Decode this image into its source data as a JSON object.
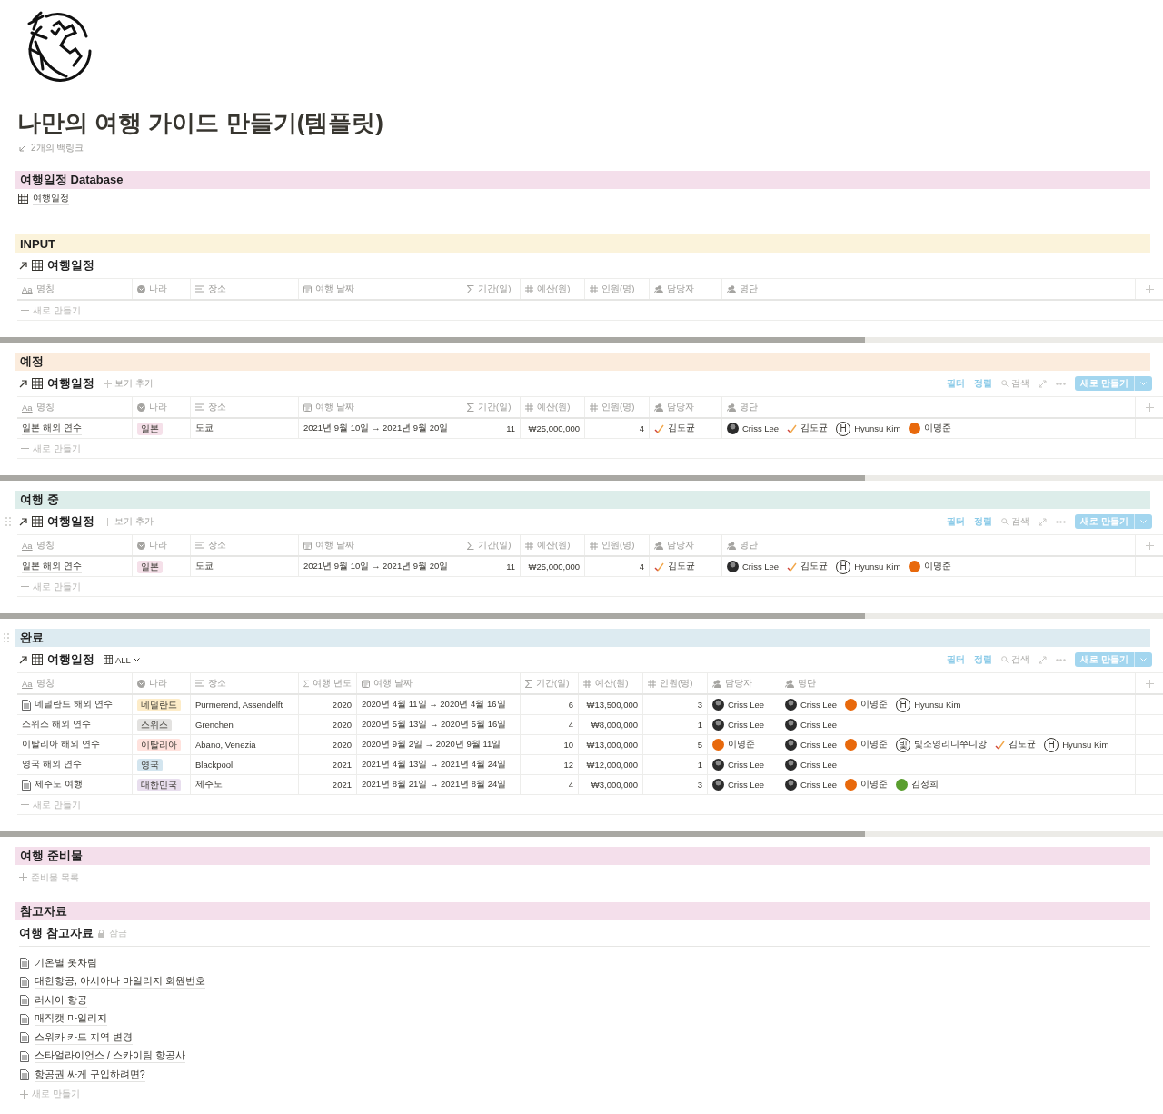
{
  "page": {
    "title": "나만의 여행 가이드 만들기(템플릿)",
    "backlinks": "2개의 백링크"
  },
  "sections": [
    {
      "kind": "link",
      "heading": "여행일정 Database",
      "color": "#f4dfeb",
      "link": "여행일정"
    },
    {
      "kind": "database",
      "heading": "INPUT",
      "color": "#fbf3db",
      "view": {
        "title": "여행일정",
        "columns": [
          {
            "kind": "title",
            "glyph": "Aa",
            "label": "명칭"
          },
          {
            "kind": "select",
            "label": "나라"
          },
          {
            "kind": "text",
            "label": "장소"
          },
          {
            "kind": "date",
            "label": "여행 날짜"
          },
          {
            "kind": "formula",
            "label": "기간(일)"
          },
          {
            "kind": "number",
            "label": "예산(원)"
          },
          {
            "kind": "number",
            "label": "인원(명)"
          },
          {
            "kind": "people",
            "label": "담당자"
          },
          {
            "kind": "people",
            "label": "명단"
          }
        ],
        "add_row": "새로 만들기"
      }
    },
    {
      "kind": "database",
      "heading": "예정",
      "color": "#fbecdd",
      "view": {
        "title": "여행일정",
        "view_add": "보기 추가",
        "toolbar": {
          "filter": "필터",
          "sort": "정렬",
          "search": "검색",
          "new": "새로 만들기"
        },
        "columns": [
          {
            "kind": "title",
            "glyph": "Aa",
            "label": "명칭"
          },
          {
            "kind": "select",
            "label": "나라"
          },
          {
            "kind": "text",
            "label": "장소"
          },
          {
            "kind": "date",
            "label": "여행 날짜"
          },
          {
            "kind": "formula",
            "label": "기간(일)"
          },
          {
            "kind": "number",
            "label": "예산(원)"
          },
          {
            "kind": "number",
            "label": "인원(명)"
          },
          {
            "kind": "people",
            "label": "담당자"
          },
          {
            "kind": "people",
            "label": "명단"
          }
        ],
        "rows": [
          {
            "doc_icon": false,
            "cells": [
              "일본 해외 연수",
              {
                "label": "일본",
                "color": "#f5e0e9"
              },
              "도쿄",
              "2021년 9월 10일 → 2021년 9월 20일",
              "11",
              "₩25,000,000",
              "4",
              [
                {
                  "kind": "check",
                  "name": "김도균"
                }
              ],
              [
                {
                  "kind": "photo",
                  "name": "Criss Lee"
                },
                {
                  "kind": "check",
                  "name": "김도균"
                },
                {
                  "kind": "letter",
                  "letter": "H",
                  "name": "Hyunsu Kim"
                },
                {
                  "kind": "dot",
                  "color": "#e8690c",
                  "name": "이명준"
                }
              ]
            ]
          }
        ],
        "add_row": "새로 만들기"
      }
    },
    {
      "kind": "database",
      "heading": "여행 중",
      "color": "#ddedea",
      "view": {
        "title": "여행일정",
        "drag_handle": true,
        "view_add": "보기 추가",
        "toolbar": {
          "filter": "필터",
          "sort": "정렬",
          "search": "검색",
          "new": "새로 만들기"
        },
        "columns": [
          {
            "kind": "title",
            "glyph": "Aa",
            "label": "명칭"
          },
          {
            "kind": "select",
            "label": "나라"
          },
          {
            "kind": "text",
            "label": "장소"
          },
          {
            "kind": "date",
            "label": "여행 날짜"
          },
          {
            "kind": "formula",
            "label": "기간(일)"
          },
          {
            "kind": "number",
            "label": "예산(원)"
          },
          {
            "kind": "number",
            "label": "인원(명)"
          },
          {
            "kind": "people",
            "label": "담당자"
          },
          {
            "kind": "people",
            "label": "명단"
          }
        ],
        "rows": [
          {
            "doc_icon": false,
            "cells": [
              "일본 해외 연수",
              {
                "label": "일본",
                "color": "#f5e0e9"
              },
              "도쿄",
              "2021년 9월 10일 → 2021년 9월 20일",
              "11",
              "₩25,000,000",
              "4",
              [
                {
                  "kind": "check",
                  "name": "김도균"
                }
              ],
              [
                {
                  "kind": "photo",
                  "name": "Criss Lee"
                },
                {
                  "kind": "check",
                  "name": "김도균"
                },
                {
                  "kind": "letter",
                  "letter": "H",
                  "name": "Hyunsu Kim"
                },
                {
                  "kind": "dot",
                  "color": "#e8690c",
                  "name": "이명준"
                }
              ]
            ]
          }
        ],
        "add_row": "새로 만들기"
      }
    },
    {
      "kind": "database",
      "heading": "완료",
      "drag_handle": true,
      "color": "#ddebf1",
      "view": {
        "title": "여행일정",
        "view_menu": "ALL",
        "toolbar": {
          "filter": "필터",
          "sort": "정렬",
          "search": "검색",
          "new": "새로 만들기"
        },
        "columns": [
          {
            "kind": "title",
            "glyph": "Aa",
            "label": "명칭"
          },
          {
            "kind": "select",
            "label": "나라"
          },
          {
            "kind": "text",
            "label": "장소"
          },
          {
            "kind": "year",
            "label": "여행 년도"
          },
          {
            "kind": "date",
            "label": "여행 날짜"
          },
          {
            "kind": "formula",
            "label": "기간(일)"
          },
          {
            "kind": "number",
            "label": "예산(원)"
          },
          {
            "kind": "number",
            "label": "인원(명)"
          },
          {
            "kind": "people",
            "label": "담당자"
          },
          {
            "kind": "people",
            "label": "명단"
          }
        ],
        "rows": [
          {
            "doc_icon": true,
            "cells": [
              "네덜란드 해외 연수",
              {
                "label": "네덜란드",
                "color": "#fdecc8"
              },
              "Purmerend, Assendelft",
              "2020",
              "2020년 4월 11일 → 2020년 4월 16일",
              "6",
              "₩13,500,000",
              "3",
              [
                {
                  "kind": "photo",
                  "name": "Criss Lee"
                }
              ],
              [
                {
                  "kind": "photo",
                  "name": "Criss Lee"
                },
                {
                  "kind": "dot",
                  "color": "#e8690c",
                  "name": "이명준"
                },
                {
                  "kind": "letter",
                  "letter": "H",
                  "name": "Hyunsu Kim"
                }
              ]
            ]
          },
          {
            "doc_icon": false,
            "cells": [
              "스위스 해외 연수",
              {
                "label": "스위스",
                "color": "#e3e2e0"
              },
              "Grenchen",
              "2020",
              "2020년 5월 13일 → 2020년 5월 16일",
              "4",
              "₩8,000,000",
              "1",
              [
                {
                  "kind": "photo",
                  "name": "Criss Lee"
                }
              ],
              [
                {
                  "kind": "photo",
                  "name": "Criss Lee"
                }
              ]
            ]
          },
          {
            "doc_icon": false,
            "cells": [
              "이탈리아 해외 연수",
              {
                "label": "이탈리아",
                "color": "#ffe2dd"
              },
              "Abano, Venezia",
              "2020",
              "2020년 9월 2일 → 2020년 9월 11일",
              "10",
              "₩13,000,000",
              "5",
              [
                {
                  "kind": "dot",
                  "color": "#e8690c",
                  "name": "이명준"
                }
              ],
              [
                {
                  "kind": "photo",
                  "name": "Criss Lee"
                },
                {
                  "kind": "dot",
                  "color": "#e8690c",
                  "name": "이명준"
                },
                {
                  "kind": "letter",
                  "letter": "빛",
                  "name": "빛소영리니쭈니앙"
                },
                {
                  "kind": "check",
                  "name": "김도균"
                },
                {
                  "kind": "letter",
                  "letter": "H",
                  "name": "Hyunsu Kim"
                }
              ]
            ]
          },
          {
            "doc_icon": false,
            "cells": [
              "영국 해외 연수",
              {
                "label": "영국",
                "color": "#d3e5ef"
              },
              "Blackpool",
              "2021",
              "2021년 4월 13일 → 2021년 4월 24일",
              "12",
              "₩12,000,000",
              "1",
              [
                {
                  "kind": "photo",
                  "name": "Criss Lee"
                }
              ],
              [
                {
                  "kind": "photo",
                  "name": "Criss Lee"
                }
              ]
            ]
          },
          {
            "doc_icon": true,
            "cells": [
              "제주도 여행",
              {
                "label": "대한민국",
                "color": "#e8deee"
              },
              "제주도",
              "2021",
              "2021년 8월 21일 → 2021년 8월 24일",
              "4",
              "₩3,000,000",
              "3",
              [
                {
                  "kind": "photo",
                  "name": "Criss Lee"
                }
              ],
              [
                {
                  "kind": "photo",
                  "name": "Criss Lee"
                },
                {
                  "kind": "dot",
                  "color": "#e8690c",
                  "name": "이명준"
                },
                {
                  "kind": "dot",
                  "color": "#5a9e2f",
                  "name": "김정희"
                }
              ]
            ]
          }
        ],
        "add_row": "새로 만들기"
      }
    },
    {
      "kind": "add",
      "heading": "여행 준비물",
      "color": "#f4dfeb",
      "add": "준비물 목록"
    },
    {
      "kind": "list",
      "heading": "참고자료",
      "color": "#f4dfeb",
      "list_title": "여행 참고자료",
      "lock": "잠금",
      "items": [
        "기온별 옷차림",
        "대한항공, 아시아나 마일리지 회원번호",
        "러시아 항공",
        "매직캣 마일리지",
        "스위카 카드 지역 변경",
        "스타얼라이언스 / 스카이팀 항공사",
        "항공권 싸게 구입하려면?"
      ],
      "add": "새로 만들기"
    }
  ]
}
